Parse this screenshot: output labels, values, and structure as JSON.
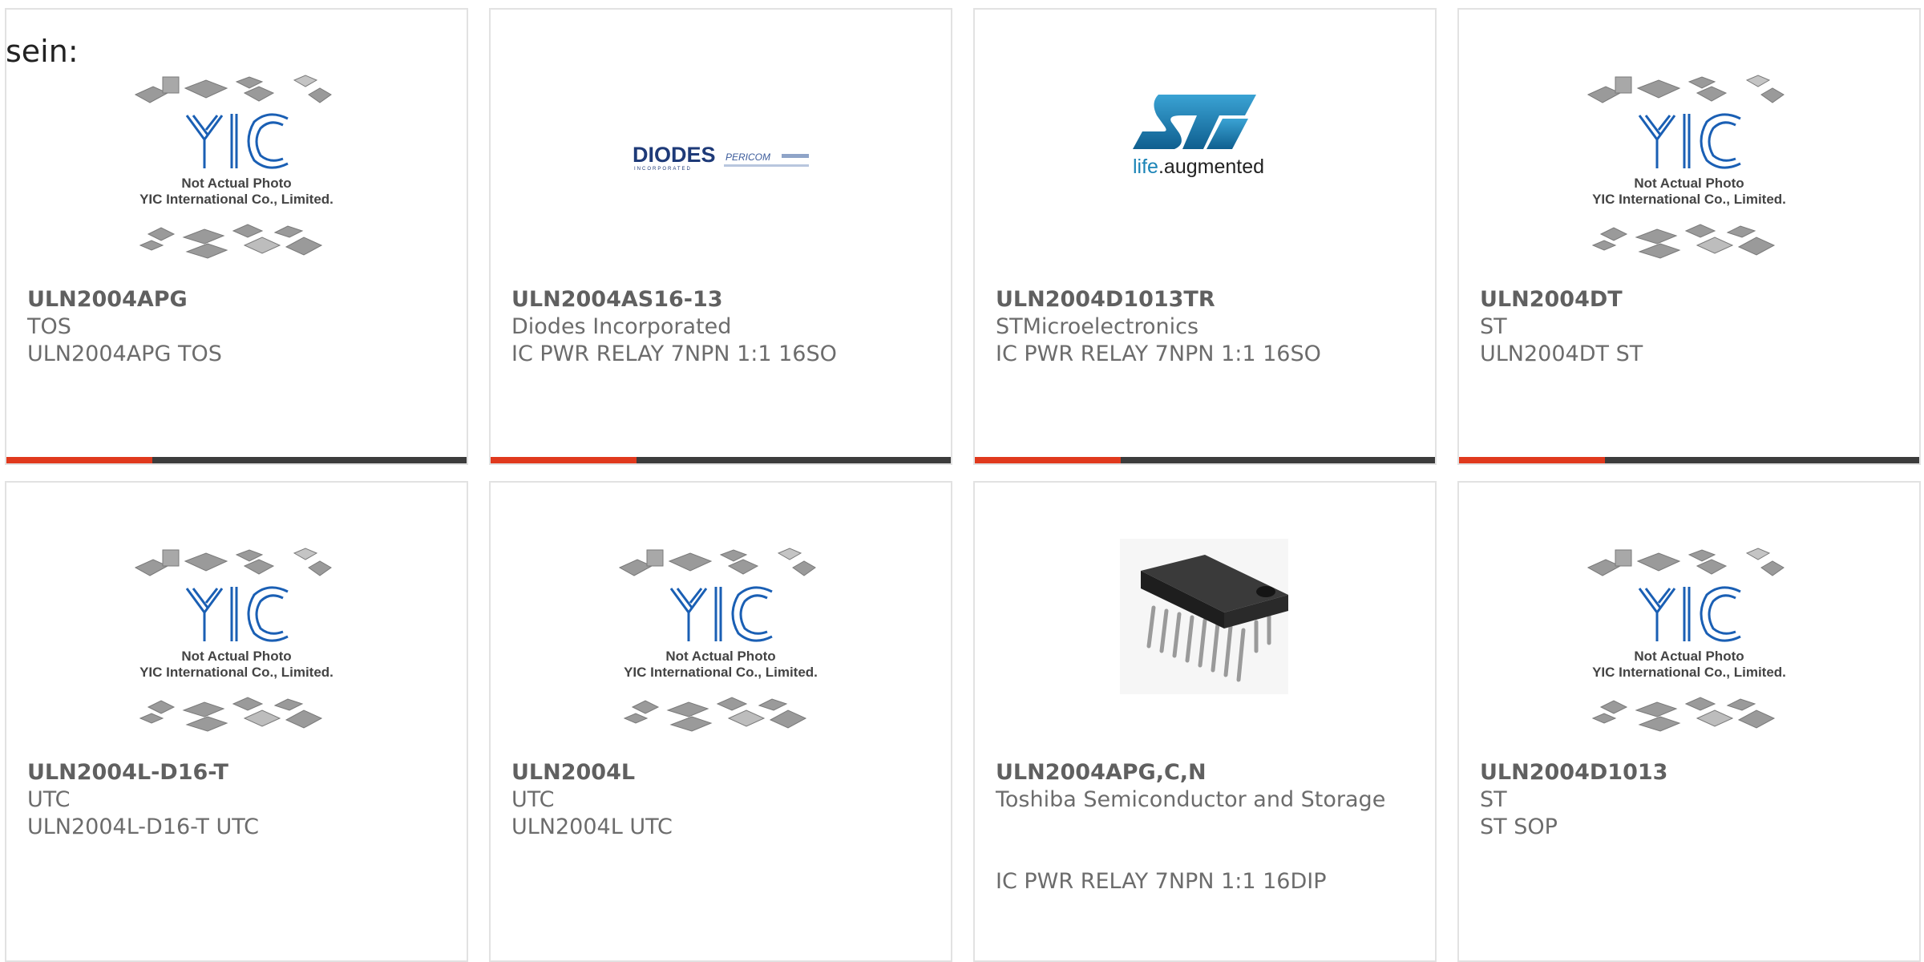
{
  "intro": "sein:",
  "colors": {
    "accent": "#e0391d",
    "bar": "#3c3c3c",
    "yic_blue": "#1a5fb4",
    "st_blue": "#1b84b7"
  },
  "placeholder": {
    "line1": "Not Actual Photo",
    "line2": "YIC International Co., Limited.",
    "logo": "YIC"
  },
  "diodes_logo": {
    "name": "DIODES",
    "tagline": "INCORPORATED",
    "pericom": "PERICOM"
  },
  "st_logo": {
    "mark": "ST",
    "tagline_a": "life",
    "tagline_b": ".augmented"
  },
  "products": [
    {
      "part": "ULN2004APG",
      "manufacturer": "TOS",
      "description": "ULN2004APG TOS",
      "image": "yic-placeholder"
    },
    {
      "part": "ULN2004AS16-13",
      "manufacturer": "Diodes Incorporated",
      "description": "IC PWR RELAY 7NPN 1:1 16SO",
      "image": "diodes-logo"
    },
    {
      "part": "ULN2004D1013TR",
      "manufacturer": "STMicroelectronics",
      "description": "IC PWR RELAY 7NPN 1:1 16SO",
      "image": "st-logo"
    },
    {
      "part": "ULN2004DT",
      "manufacturer": "ST",
      "description": "ULN2004DT ST",
      "image": "yic-placeholder"
    },
    {
      "part": "ULN2004L-D16-T",
      "manufacturer": "UTC",
      "description": "ULN2004L-D16-T UTC",
      "image": "yic-placeholder"
    },
    {
      "part": "ULN2004L",
      "manufacturer": "UTC",
      "description": "ULN2004L UTC",
      "image": "yic-placeholder"
    },
    {
      "part": "ULN2004APG,C,N",
      "manufacturer": "Toshiba Semiconductor and Storage",
      "description": "IC PWR RELAY 7NPN 1:1 16DIP",
      "image": "dip16-chip-photo"
    },
    {
      "part": "ULN2004D1013",
      "manufacturer": "ST",
      "description": "ST SOP",
      "image": "yic-placeholder"
    }
  ]
}
